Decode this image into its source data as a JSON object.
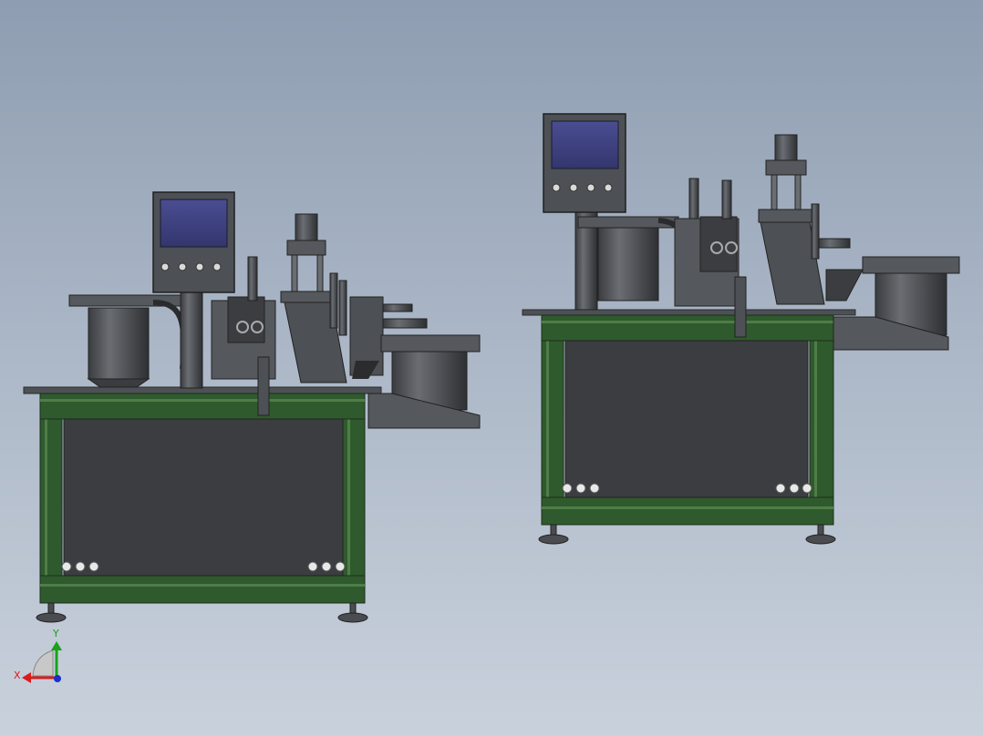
{
  "viewport": {
    "background_top": "#8e9db1",
    "background_bottom": "#c9d1dc"
  },
  "colors": {
    "frame_green": "#2f5a2d",
    "frame_green_light": "#4f7d48",
    "panel_dark": "#3b3d40",
    "part_gray": "#55585c",
    "part_light": "#707378",
    "screen_blue": "#3c3f7a",
    "axis_x": "#d91c1c",
    "axis_y": "#19a319",
    "axis_z": "#1b2fd0"
  },
  "models": [
    {
      "name": "machine-front-view",
      "parts": [
        "frame",
        "touch-screen-panel",
        "bowl-feeder-left",
        "bowl-feeder-right",
        "press-cylinder",
        "tooling-block"
      ]
    },
    {
      "name": "machine-angled-view",
      "parts": [
        "frame",
        "touch-screen-panel",
        "bowl-feeder-left",
        "bowl-feeder-right",
        "press-cylinder",
        "tooling-block"
      ]
    }
  ],
  "triad": {
    "x_label": "X",
    "y_label": "Y"
  }
}
